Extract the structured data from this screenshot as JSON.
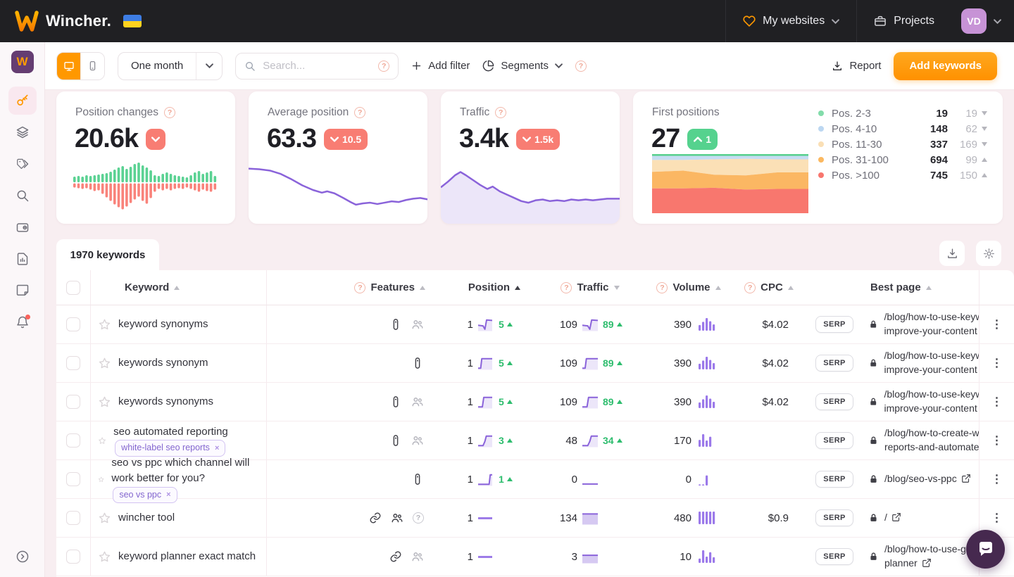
{
  "header": {
    "brand": "Wincher.",
    "my_websites": "My websites",
    "projects": "Projects",
    "avatar": "VD"
  },
  "toolbar": {
    "period": "One month",
    "search_placeholder": "Search...",
    "add_filter": "Add filter",
    "segments": "Segments",
    "report": "Report",
    "add_keywords": "Add keywords"
  },
  "colors": {
    "orange": "#ff9800",
    "red_badge": "#f87d73",
    "green_badge": "#55d28e",
    "green_text": "#2ebd6e",
    "purple_line": "#8a63da",
    "purple_fill": "rgba(138,99,218,0.16)",
    "purple_solid": "rgba(138,99,218,0.35)",
    "volume_bar": "#9b79ea",
    "green_bar": "#5bd293",
    "red_bar": "#f9837b"
  },
  "icons": {
    "help": "circled-question",
    "sort_asc": "triangle-up",
    "sort_desc": "triangle-down",
    "lock": "padlock",
    "external": "external-link",
    "row_menu": "vertical-dots"
  },
  "stats": {
    "position_changes": {
      "title": "Position changes",
      "value": "20.6k",
      "direction": "down"
    },
    "average_position": {
      "title": "Average position",
      "value": "63.3",
      "change": "10.5",
      "direction": "down"
    },
    "traffic": {
      "title": "Traffic",
      "value": "3.4k",
      "change": "1.5k",
      "direction": "down"
    },
    "first_positions": {
      "title": "First positions",
      "value": "27",
      "change": "1",
      "direction": "up",
      "legend": [
        {
          "label": "Pos. 2-3",
          "value": "19",
          "change": "19",
          "dir": "down",
          "color": "#82dcaa"
        },
        {
          "label": "Pos. 4-10",
          "value": "148",
          "change": "62",
          "dir": "down",
          "color": "#bcd7f1"
        },
        {
          "label": "Pos. 11-30",
          "value": "337",
          "change": "169",
          "dir": "down",
          "color": "#fadfb5"
        },
        {
          "label": "Pos. 31-100",
          "value": "694",
          "change": "99",
          "dir": "up",
          "color": "#fbb860"
        },
        {
          "label": "Pos. >100",
          "value": "745",
          "change": "150",
          "dir": "up",
          "color": "#f8766e"
        }
      ]
    }
  },
  "charts": {
    "position_changes_bars": [
      [
        8,
        6
      ],
      [
        9,
        7
      ],
      [
        8,
        8
      ],
      [
        10,
        7
      ],
      [
        9,
        9
      ],
      [
        10,
        11
      ],
      [
        11,
        10
      ],
      [
        12,
        15
      ],
      [
        13,
        20
      ],
      [
        15,
        25
      ],
      [
        18,
        30
      ],
      [
        21,
        34
      ],
      [
        23,
        37
      ],
      [
        19,
        33
      ],
      [
        22,
        28
      ],
      [
        26,
        23
      ],
      [
        28,
        19
      ],
      [
        24,
        25
      ],
      [
        21,
        29
      ],
      [
        17,
        21
      ],
      [
        10,
        12
      ],
      [
        9,
        8
      ],
      [
        12,
        10
      ],
      [
        14,
        8
      ],
      [
        12,
        10
      ],
      [
        10,
        8
      ],
      [
        9,
        7
      ],
      [
        8,
        8
      ],
      [
        7,
        6
      ],
      [
        10,
        8
      ],
      [
        14,
        10
      ],
      [
        16,
        12
      ],
      [
        12,
        9
      ],
      [
        14,
        11
      ],
      [
        16,
        12
      ],
      [
        9,
        9
      ]
    ],
    "average_position_line": [
      [
        0,
        28
      ],
      [
        6,
        29
      ],
      [
        12,
        31
      ],
      [
        18,
        36
      ],
      [
        24,
        44
      ],
      [
        30,
        53
      ],
      [
        36,
        60
      ],
      [
        41,
        64
      ],
      [
        44,
        62
      ],
      [
        48,
        65
      ],
      [
        53,
        72
      ],
      [
        57,
        78
      ],
      [
        60,
        82
      ],
      [
        64,
        80
      ],
      [
        68,
        79
      ],
      [
        72,
        81
      ],
      [
        76,
        79
      ],
      [
        80,
        77
      ],
      [
        84,
        78
      ],
      [
        88,
        75
      ],
      [
        92,
        73
      ],
      [
        96,
        72
      ],
      [
        100,
        74
      ]
    ],
    "traffic_area": [
      [
        0,
        55
      ],
      [
        4,
        48
      ],
      [
        8,
        40
      ],
      [
        11,
        36
      ],
      [
        14,
        40
      ],
      [
        18,
        46
      ],
      [
        22,
        52
      ],
      [
        26,
        57
      ],
      [
        29,
        54
      ],
      [
        33,
        60
      ],
      [
        37,
        64
      ],
      [
        41,
        68
      ],
      [
        45,
        72
      ],
      [
        49,
        74
      ],
      [
        53,
        71
      ],
      [
        57,
        70
      ],
      [
        61,
        72
      ],
      [
        65,
        71
      ],
      [
        69,
        72
      ],
      [
        73,
        70
      ],
      [
        77,
        71
      ],
      [
        81,
        70
      ],
      [
        85,
        71
      ],
      [
        89,
        70
      ],
      [
        93,
        69
      ],
      [
        100,
        69
      ]
    ],
    "first_positions_stack": {
      "x": [
        0,
        20,
        40,
        60,
        80,
        100
      ],
      "bands": [
        {
          "name": "pos-2-3",
          "color": "#57d08d",
          "heights": [
            3,
            3,
            3,
            3,
            3,
            3
          ]
        },
        {
          "name": "pos-4-10",
          "color": "#c6dcf2",
          "heights": [
            7,
            7,
            6,
            5,
            6,
            6
          ]
        },
        {
          "name": "pos-11-30",
          "color": "#fbe0b6",
          "heights": [
            20,
            18,
            26,
            28,
            22,
            22
          ]
        },
        {
          "name": "pos-31-100",
          "color": "#fbb763",
          "heights": [
            28,
            30,
            22,
            24,
            28,
            28
          ]
        },
        {
          "name": "pos-gt-100",
          "color": "#f8776e",
          "heights": [
            42,
            42,
            43,
            40,
            41,
            41
          ]
        }
      ]
    },
    "sparks": {
      "zigzag": [
        [
          0,
          55
        ],
        [
          35,
          60
        ],
        [
          48,
          90
        ],
        [
          60,
          8
        ],
        [
          100,
          12
        ]
      ],
      "step": [
        [
          0,
          92
        ],
        [
          18,
          92
        ],
        [
          26,
          8
        ],
        [
          100,
          8
        ]
      ],
      "step2": [
        [
          0,
          92
        ],
        [
          30,
          92
        ],
        [
          40,
          8
        ],
        [
          100,
          8
        ]
      ],
      "rise": [
        [
          0,
          92
        ],
        [
          35,
          92
        ],
        [
          48,
          55
        ],
        [
          58,
          8
        ],
        [
          100,
          8
        ]
      ],
      "latespike": [
        [
          0,
          92
        ],
        [
          78,
          92
        ],
        [
          86,
          8
        ],
        [
          100,
          8
        ]
      ],
      "flatlow": [
        [
          0,
          90
        ],
        [
          100,
          90
        ]
      ],
      "dash": [
        [
          0,
          50
        ],
        [
          100,
          50
        ]
      ],
      "block": [
        [
          0,
          12
        ],
        [
          100,
          12
        ]
      ],
      "block2": [
        [
          0,
          35
        ],
        [
          100,
          35
        ]
      ]
    }
  },
  "table": {
    "tab_label": "1970 keywords",
    "columns": [
      {
        "label": "Keyword",
        "help": false,
        "sort": "asc",
        "active": false
      },
      {
        "label": "Features",
        "help": true,
        "sort": "asc",
        "active": false
      },
      {
        "label": "Position",
        "help": false,
        "sort": "asc",
        "active": true
      },
      {
        "label": "Traffic",
        "help": true,
        "sort": "desc",
        "active": false
      },
      {
        "label": "Volume",
        "help": true,
        "sort": "asc",
        "active": false
      },
      {
        "label": "CPC",
        "help": true,
        "sort": "asc",
        "active": false
      },
      {
        "label": "Best page",
        "help": false,
        "sort": "asc",
        "active": false
      }
    ],
    "rows": [
      {
        "keyword": "keyword synonyms",
        "tag": "",
        "features": [
          "serp-feature:dark",
          "people:gray"
        ],
        "position": "1",
        "pos_spark": "zigzag:fill",
        "pos_change": "5",
        "traffic": "109",
        "traffic_spark": "zigzag:fill",
        "traffic_change": "89",
        "volume": "390",
        "volume_bars": [
          0.45,
          0.7,
          1,
          0.75,
          0.5
        ],
        "cpc": "$4.02",
        "serp": "SERP",
        "page": [
          "/blog/how-to-use-keyw",
          "improve-your-content"
        ],
        "page_external": false
      },
      {
        "keyword": "keywords synonym",
        "tag": "",
        "features": [
          "serp-feature:dark"
        ],
        "position": "1",
        "pos_spark": "step:fill",
        "pos_change": "5",
        "traffic": "109",
        "traffic_spark": "step:fill",
        "traffic_change": "89",
        "volume": "390",
        "volume_bars": [
          0.45,
          0.7,
          1,
          0.75,
          0.5
        ],
        "cpc": "$4.02",
        "serp": "SERP",
        "page": [
          "/blog/how-to-use-keyw",
          "improve-your-content"
        ],
        "page_external": false
      },
      {
        "keyword": "keywords synonyms",
        "tag": "",
        "features": [
          "serp-feature:dark",
          "people:gray"
        ],
        "position": "1",
        "pos_spark": "step2:fill",
        "pos_change": "5",
        "traffic": "109",
        "traffic_spark": "step2:fill",
        "traffic_change": "89",
        "volume": "390",
        "volume_bars": [
          0.45,
          0.7,
          1,
          0.75,
          0.5
        ],
        "cpc": "$4.02",
        "serp": "SERP",
        "page": [
          "/blog/how-to-use-keyw",
          "improve-your-content"
        ],
        "page_external": false
      },
      {
        "keyword": "seo automated reporting",
        "tag": "white-label seo reports",
        "features": [
          "serp-feature:dark",
          "people:gray"
        ],
        "position": "1",
        "pos_spark": "rise:fill",
        "pos_change": "3",
        "traffic": "48",
        "traffic_spark": "rise:fill",
        "traffic_change": "34",
        "volume": "170",
        "volume_bars": [
          0.55,
          1,
          0.5,
          0.8
        ],
        "cpc": "",
        "serp": "SERP",
        "page": [
          "/blog/how-to-create-w",
          "reports-and-automate"
        ],
        "page_external": false
      },
      {
        "keyword": "seo vs ppc which channel will work better for you?",
        "tag": "seo vs ppc",
        "features": [
          "serp-feature:dark"
        ],
        "position": "1",
        "pos_spark": "latespike:fill",
        "pos_change": "1",
        "traffic": "0",
        "traffic_spark": "flatlow:line",
        "traffic_change": "",
        "volume": "0",
        "volume_bars": [
          0.07,
          0.07,
          0.8
        ],
        "cpc": "",
        "serp": "SERP",
        "page": [
          "/blog/seo-vs-ppc"
        ],
        "page_external": true
      },
      {
        "keyword": "wincher tool",
        "tag": "",
        "features": [
          "link:dark",
          "people:dark",
          "question:gray"
        ],
        "position": "1",
        "pos_spark": "dash:line",
        "pos_change": "",
        "traffic": "134",
        "traffic_spark": "block:solid",
        "traffic_change": "",
        "volume": "480",
        "volume_bars": [
          1,
          1,
          1,
          1,
          1
        ],
        "cpc": "$0.9",
        "serp": "SERP",
        "page": [
          "/"
        ],
        "page_external": true
      },
      {
        "keyword": "keyword planner exact match",
        "tag": "",
        "features": [
          "link:dark",
          "people:gray"
        ],
        "position": "1",
        "pos_spark": "dash:line",
        "pos_change": "",
        "traffic": "3",
        "traffic_spark": "block2:solid",
        "traffic_change": "",
        "volume": "10",
        "volume_bars": [
          0.35,
          1,
          0.5,
          0.85,
          0.45
        ],
        "cpc": "",
        "serp": "SERP",
        "page": [
          "/blog/how-to-use-go",
          "planner"
        ],
        "page_external": true
      }
    ]
  }
}
